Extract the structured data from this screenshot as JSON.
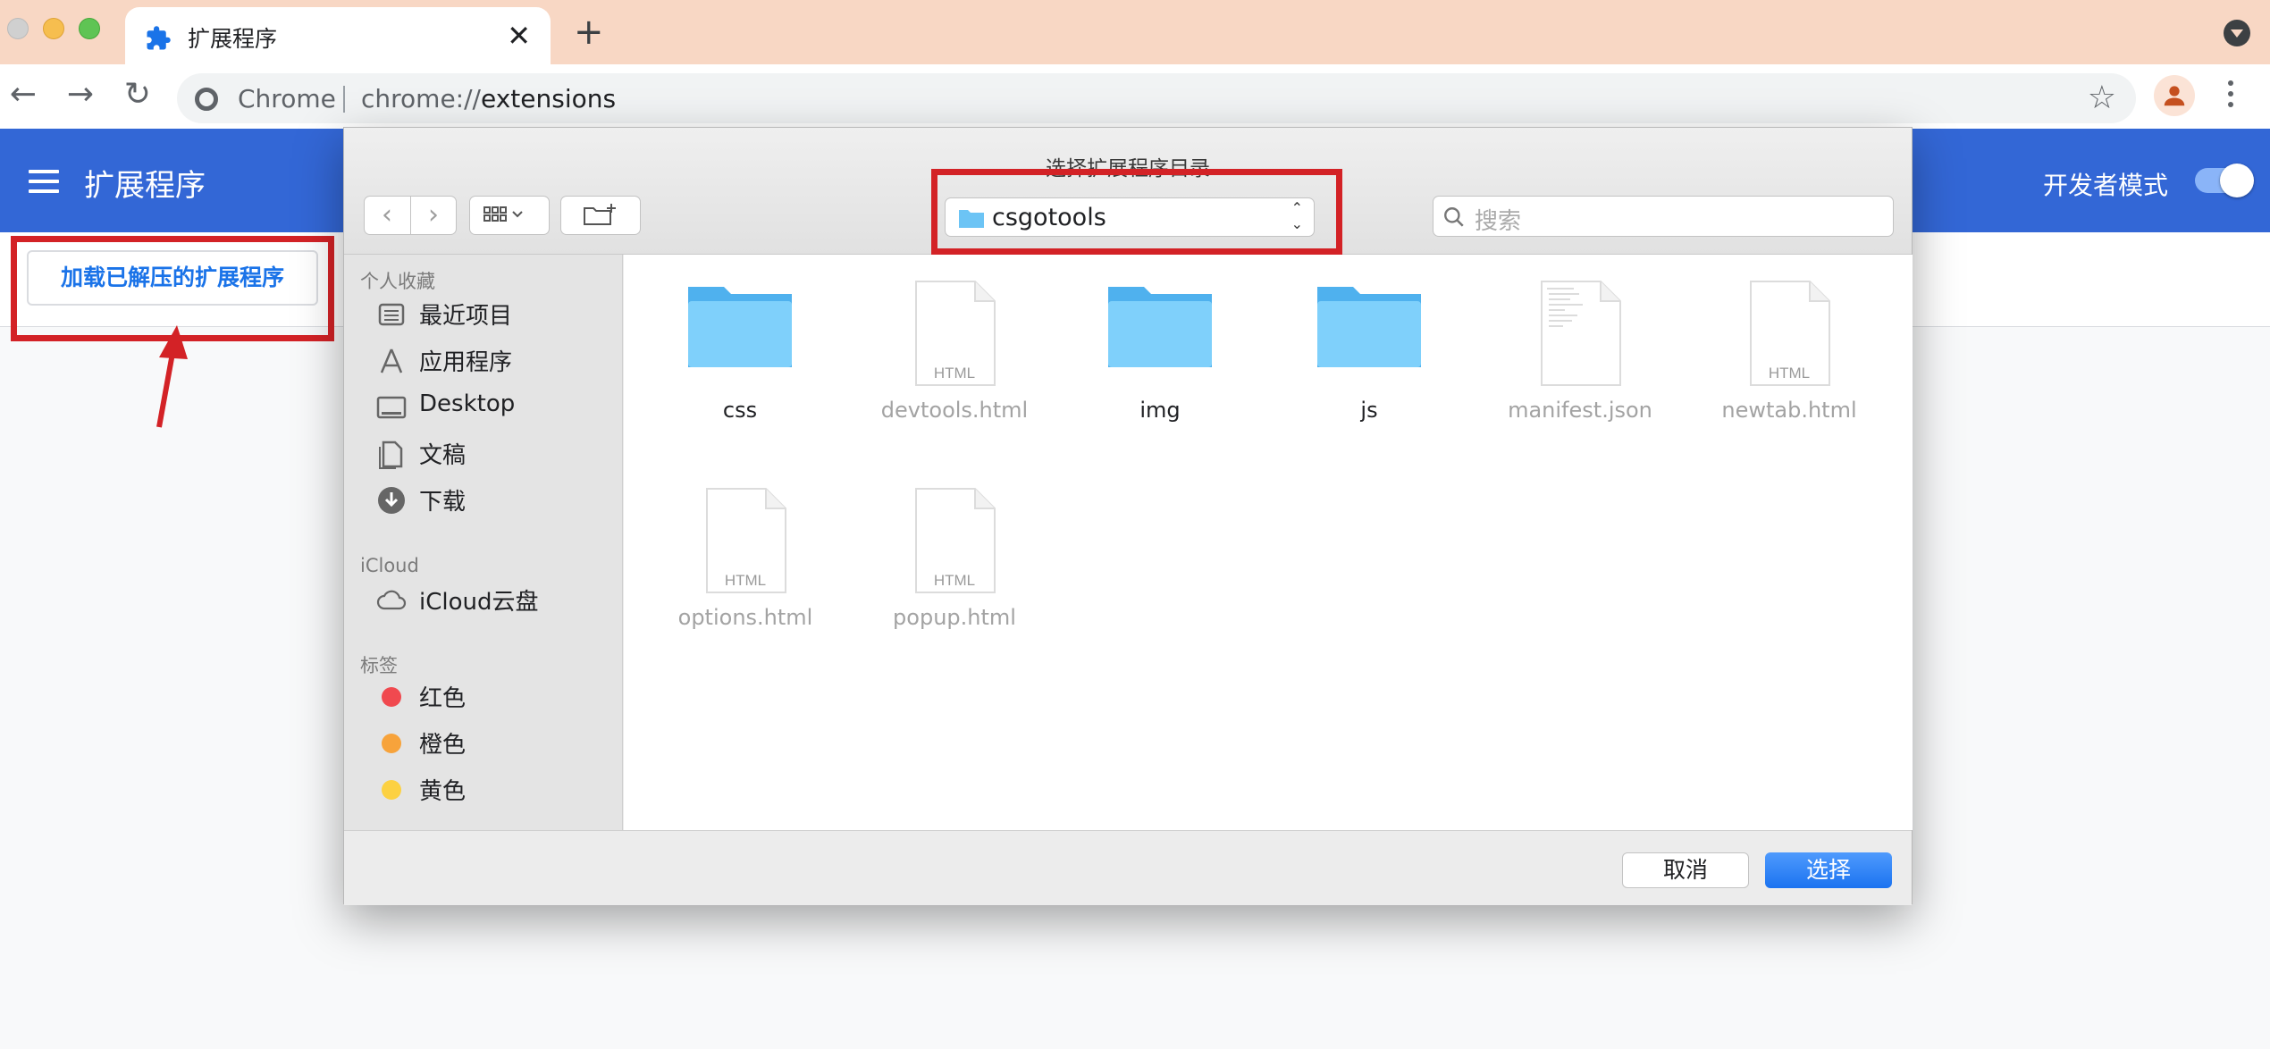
{
  "browser": {
    "tab_title": "扩展程序",
    "site_name": "Chrome",
    "url_scheme": "chrome://",
    "url_path": "extensions"
  },
  "extensions_page": {
    "title": "扩展程序",
    "developer_mode_label": "开发者模式",
    "developer_mode_on": true,
    "load_unpacked_label": "加载已解压的扩展程序"
  },
  "dialog": {
    "title": "选择扩展程序目录",
    "current_folder": "csgotools",
    "search_placeholder": "搜索",
    "sidebar": {
      "favorites_header": "个人收藏",
      "favorites": [
        {
          "label": "最近项目",
          "icon": "recents-icon"
        },
        {
          "label": "应用程序",
          "icon": "applications-icon"
        },
        {
          "label": "Desktop",
          "icon": "desktop-icon"
        },
        {
          "label": "文稿",
          "icon": "documents-icon"
        },
        {
          "label": "下载",
          "icon": "downloads-icon"
        }
      ],
      "icloud_header": "iCloud",
      "icloud": [
        {
          "label": "iCloud云盘",
          "icon": "cloud-icon"
        }
      ],
      "tags_header": "标签",
      "tags": [
        {
          "label": "红色",
          "color": "#f0494f"
        },
        {
          "label": "橙色",
          "color": "#f7a33b"
        },
        {
          "label": "黄色",
          "color": "#fcd142"
        }
      ]
    },
    "files": [
      {
        "name": "css",
        "kind": "folder",
        "enabled": true
      },
      {
        "name": "devtools.html",
        "kind": "html",
        "badge": "HTML",
        "enabled": false
      },
      {
        "name": "img",
        "kind": "folder",
        "enabled": true
      },
      {
        "name": "js",
        "kind": "folder",
        "enabled": true
      },
      {
        "name": "manifest.json",
        "kind": "json",
        "enabled": false
      },
      {
        "name": "newtab.html",
        "kind": "html",
        "badge": "HTML",
        "enabled": false
      },
      {
        "name": "options.html",
        "kind": "html",
        "badge": "HTML",
        "enabled": false
      },
      {
        "name": "popup.html",
        "kind": "html",
        "badge": "HTML",
        "enabled": false
      }
    ],
    "cancel_label": "取消",
    "choose_label": "选择"
  },
  "colors": {
    "accent_blue": "#3367d6",
    "highlight_red": "#d32226",
    "folder_blue": "#6cc4f5"
  }
}
